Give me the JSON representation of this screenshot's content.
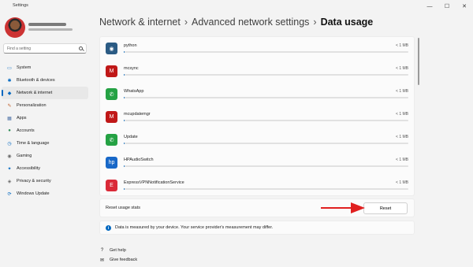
{
  "window": {
    "title": "Settings",
    "controls": {
      "minimize": "—",
      "maximize": "☐",
      "close": "✕"
    }
  },
  "sidebar": {
    "search_placeholder": "Find a setting",
    "items": [
      {
        "label": "System",
        "icon": "monitor-icon",
        "glyph": "▭",
        "color": "#0067c0",
        "active": false
      },
      {
        "label": "Bluetooth & devices",
        "icon": "bluetooth-icon",
        "glyph": "✱",
        "color": "#0067c0",
        "active": false
      },
      {
        "label": "Network & internet",
        "icon": "wifi-icon",
        "glyph": "◆",
        "color": "#0067c0",
        "active": true
      },
      {
        "label": "Personalization",
        "icon": "brush-icon",
        "glyph": "✎",
        "color": "#c0602b",
        "active": false
      },
      {
        "label": "Apps",
        "icon": "apps-icon",
        "glyph": "▦",
        "color": "#4a6fa5",
        "active": false
      },
      {
        "label": "Accounts",
        "icon": "person-icon",
        "glyph": "●",
        "color": "#2e8b57",
        "active": false
      },
      {
        "label": "Time & language",
        "icon": "clock-globe-icon",
        "glyph": "◷",
        "color": "#0067c0",
        "active": false
      },
      {
        "label": "Gaming",
        "icon": "controller-icon",
        "glyph": "◉",
        "color": "#6b6b6b",
        "active": false
      },
      {
        "label": "Accessibility",
        "icon": "accessibility-icon",
        "glyph": "✦",
        "color": "#0067c0",
        "active": false
      },
      {
        "label": "Privacy & security",
        "icon": "shield-icon",
        "glyph": "◈",
        "color": "#6b6b6b",
        "active": false
      },
      {
        "label": "Windows Update",
        "icon": "update-icon",
        "glyph": "⟳",
        "color": "#0067c0",
        "active": false
      }
    ]
  },
  "breadcrumb": {
    "items": [
      "Network & internet",
      "Advanced network settings"
    ],
    "separator": "›",
    "current": "Data usage"
  },
  "apps": [
    {
      "name": "python",
      "size": "< 1 MB",
      "usage": 0.004,
      "icon": "python-icon",
      "bg": "#2b5b84",
      "glyph": "◉"
    },
    {
      "name": "mcsync",
      "size": "< 1 MB",
      "usage": 0.004,
      "icon": "mcafee-icon",
      "bg": "#c01818",
      "glyph": "M"
    },
    {
      "name": "WhatsApp",
      "size": "< 1 MB",
      "usage": 0.004,
      "icon": "whatsapp-icon",
      "bg": "#25a244",
      "glyph": "✆"
    },
    {
      "name": "mcupdatemgr",
      "size": "< 1 MB",
      "usage": 0.004,
      "icon": "mcafee-icon",
      "bg": "#c01818",
      "glyph": "M"
    },
    {
      "name": "Update",
      "size": "< 1 MB",
      "usage": 0.004,
      "icon": "whatsapp-icon",
      "bg": "#25a244",
      "glyph": "✆"
    },
    {
      "name": "HPAudioSwitch",
      "size": "< 1 MB",
      "usage": 0.004,
      "icon": "hp-icon",
      "bg": "#1868c8",
      "glyph": "hp"
    },
    {
      "name": "ExpressVPNNotificationService",
      "size": "< 1 MB",
      "usage": 0.004,
      "icon": "expressvpn-icon",
      "bg": "#da2a38",
      "glyph": "E"
    }
  ],
  "reset": {
    "label": "Reset usage stats",
    "button": "Reset"
  },
  "info": {
    "icon": "i",
    "text": "Data is measured by your device. Your service provider's measurement may differ."
  },
  "help": [
    {
      "label": "Get help",
      "icon": "help-icon",
      "glyph": "?"
    },
    {
      "label": "Give feedback",
      "icon": "feedback-icon",
      "glyph": "✉"
    }
  ],
  "colors": {
    "accent": "#0067c0",
    "arrow": "#e02020"
  }
}
